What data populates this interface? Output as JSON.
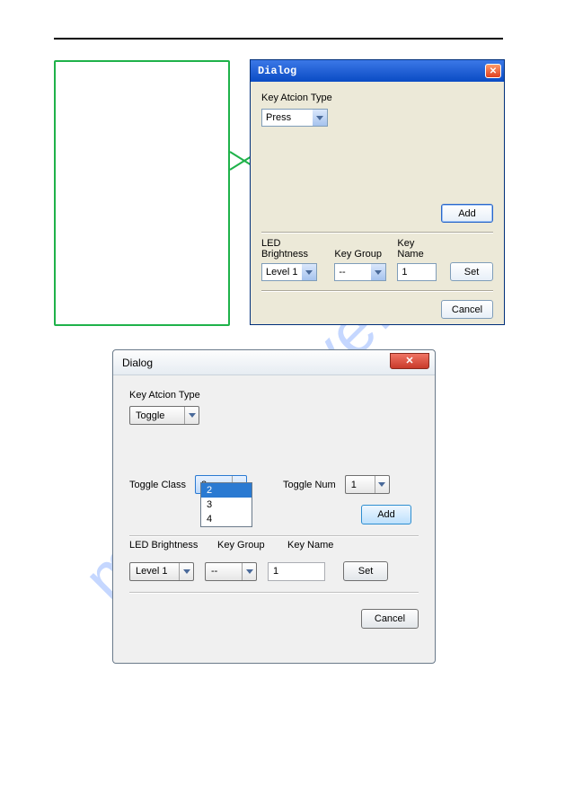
{
  "watermark": "manualshive.com",
  "dialog1": {
    "title": "Dialog",
    "key_action_type_label": "Key Atcion Type",
    "key_action_type_value": "Press",
    "add_label": "Add",
    "led_brightness_label": "LED Brightness",
    "led_brightness_value": "Level 1",
    "key_group_label": "Key Group",
    "key_group_value": "--",
    "key_name_label": "Key Name",
    "key_name_value": "1",
    "set_label": "Set",
    "cancel_label": "Cancel"
  },
  "dialog2": {
    "title": "Dialog",
    "key_action_type_label": "Key Atcion Type",
    "key_action_type_value": "Toggle",
    "toggle_class_label": "Toggle Class",
    "toggle_class_value": "2",
    "toggle_class_options": [
      "2",
      "3",
      "4"
    ],
    "toggle_num_label": "Toggle Num",
    "toggle_num_value": "1",
    "add_label": "Add",
    "led_brightness_label": "LED Brightness",
    "led_brightness_value": "Level 1",
    "key_group_label": "Key Group",
    "key_group_value": "--",
    "key_name_label": "Key Name",
    "key_name_value": "1",
    "set_label": "Set",
    "cancel_label": "Cancel"
  }
}
